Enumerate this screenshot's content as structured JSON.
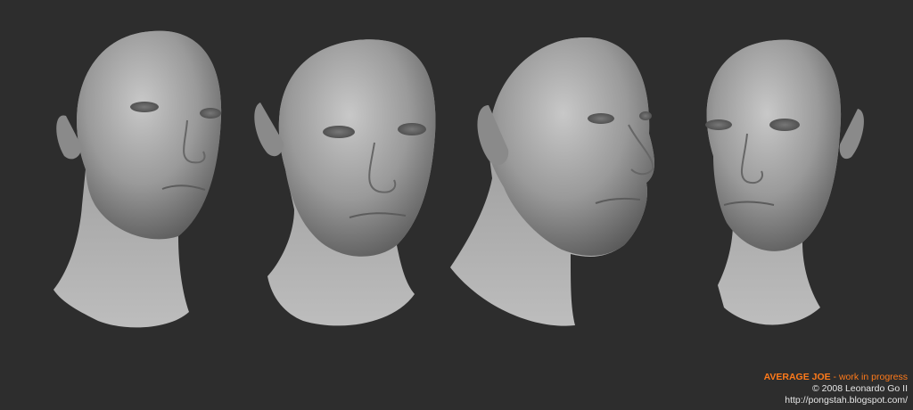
{
  "caption": {
    "title": "AVERAGE JOE",
    "subtitle": " - work in progress",
    "copyright": "© 2008 Leonardo Go II",
    "url": "http://pongstah.blogspot.com/"
  },
  "colors": {
    "background": "#2d2d2d",
    "accent": "#ff7a1a",
    "text": "#e6e6e6"
  }
}
